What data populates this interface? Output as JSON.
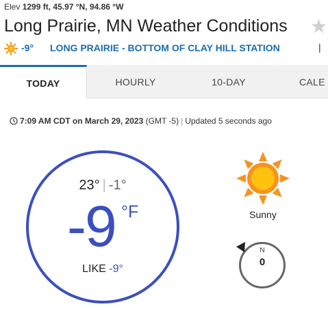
{
  "header": {
    "elev_label": "Elev",
    "elev_value": "1299 ft,",
    "lat": "45.97 °N,",
    "lon": "94.86 °W",
    "title": "Long Prairie, MN Weather Conditions",
    "favorite_icon": "star-icon"
  },
  "station": {
    "icon": "sun-icon",
    "temp": "-9°",
    "name": "LONG PRAIRIE - BOTTOM OF CLAY HILL STATION",
    "separator": "|",
    "more_icon": "station-switch-icon"
  },
  "tabs": [
    {
      "label": "TODAY",
      "active": true
    },
    {
      "label": "HOURLY",
      "active": false
    },
    {
      "label": "10-DAY",
      "active": false
    },
    {
      "label": "CALE",
      "active": false
    }
  ],
  "timestamp": {
    "clock_icon": "clock-icon",
    "time": "7:09 AM CDT on March 29, 2023",
    "tz": "(GMT -5)",
    "separator": "|",
    "updated": "Updated 5 seconds ago"
  },
  "current": {
    "high": "23°",
    "sep": "|",
    "low": "-1°",
    "temp": "-9",
    "unit": "°F",
    "feels_label": "LIKE",
    "feels_value": "-9°"
  },
  "condition": {
    "icon": "sunny-icon",
    "text": "Sunny"
  },
  "wind": {
    "direction": "N",
    "speed": "0"
  },
  "colors": {
    "accent": "#1a6db4",
    "temp_blue": "#3b4fbf",
    "sun_orange": "#f7931e",
    "sun_core": "#ffc20e"
  }
}
